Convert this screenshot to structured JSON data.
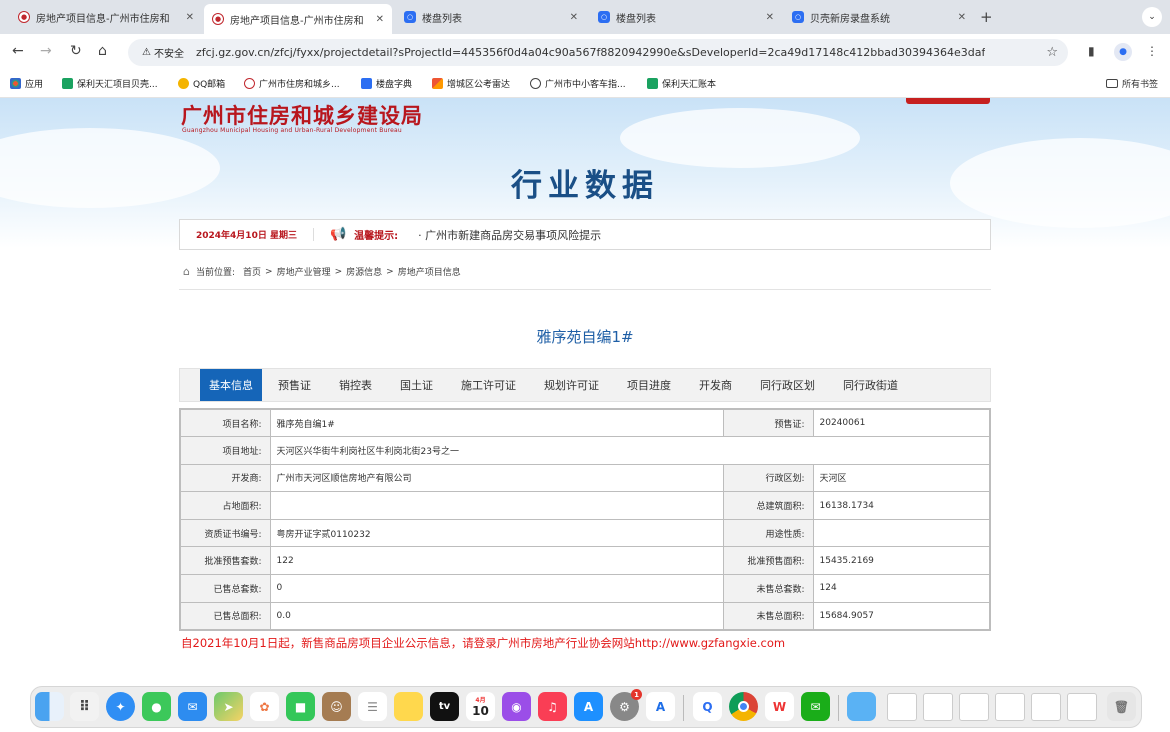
{
  "browser": {
    "tabs": [
      {
        "title": "房地产项目信息-广州市住房和",
        "icon": "gov-seal-icon",
        "active": false
      },
      {
        "title": "房地产项目信息-广州市住房和",
        "icon": "gov-seal-icon",
        "active": true
      },
      {
        "title": "楼盘列表",
        "icon": "app-icon",
        "active": false
      },
      {
        "title": "楼盘列表",
        "icon": "app-icon",
        "active": false
      },
      {
        "title": "贝壳新房录盘系统",
        "icon": "app-icon",
        "active": false
      }
    ],
    "insecure_label": "不安全",
    "url": "zfcj.gz.gov.cn/zfcj/fyxx/projectdetail?sProjectId=445356f0d4a04c90a567f8820942990e&sDeveloperId=2ca49d17148c412bbad30394364e3daf",
    "bookmarks": [
      "应用",
      "保利天汇项目贝壳...",
      "QQ邮箱",
      "广州市住房和城乡...",
      "楼盘字典",
      "增城区公考雷达",
      "广州市中小客车指...",
      "保利天汇账本"
    ],
    "all_bookmarks": "所有书签"
  },
  "site": {
    "logo_cn": "广州市住房和城乡建设局",
    "logo_en": "Guangzhou Municipal Housing and Urban-Rural Development Bureau",
    "heading": "行业数据",
    "date": "2024年4月10日 星期三",
    "notice_label": "温馨提示:",
    "notice_text": "· 广州市新建商品房交易事项风险提示",
    "breadcrumb_prefix": "当前位置:",
    "breadcrumb": [
      "首页",
      "房地产业管理",
      "房源信息",
      "房地产项目信息"
    ]
  },
  "project": {
    "title": "雅序苑自编1#",
    "tabs": [
      "基本信息",
      "预售证",
      "销控表",
      "国土证",
      "施工许可证",
      "规划许可证",
      "项目进度",
      "开发商",
      "同行政区划",
      "同行政街道"
    ],
    "fields": {
      "name_label": "项目名称:",
      "name": "雅序苑自编1#",
      "presale_label": "预售证:",
      "presale": "20240061",
      "address_label": "项目地址:",
      "address": "天河区兴华街牛利岗社区牛利岗北街23号之一",
      "developer_label": "开发商:",
      "developer": "广州市天河区顺信房地产有限公司",
      "district_label": "行政区划:",
      "district": "天河区",
      "land_area_label": "占地面积:",
      "land_area": "",
      "total_area_label": "总建筑面积:",
      "total_area": "16138.1734",
      "cert_label": "资质证书编号:",
      "cert": "粤房开证字贰0110232",
      "usage_label": "用途性质:",
      "usage": "",
      "approved_units_label": "批准预售套数:",
      "approved_units": "122",
      "approved_area_label": "批准预售面积:",
      "approved_area": "15435.2169",
      "sold_units_label": "已售总套数:",
      "sold_units": "0",
      "unsold_units_label": "未售总套数:",
      "unsold_units": "124",
      "sold_area_label": "已售总面积:",
      "sold_area": "0.0",
      "unsold_area_label": "未售总面积:",
      "unsold_area": "15684.9057"
    },
    "footer_notice": "自2021年10月1日起，新售商品房项目企业公示信息，请登录广州市房地产行业协会网站http://www.gzfangxie.com"
  },
  "dock": {
    "calendar_month": "4月",
    "calendar_day": "10",
    "tv_label": "tv",
    "badge_count": "1"
  },
  "colors": {
    "brand_red": "#b8161d",
    "heading_blue": "#1a4f86",
    "tab_active": "#1565b8",
    "notice_red": "#e21919"
  }
}
